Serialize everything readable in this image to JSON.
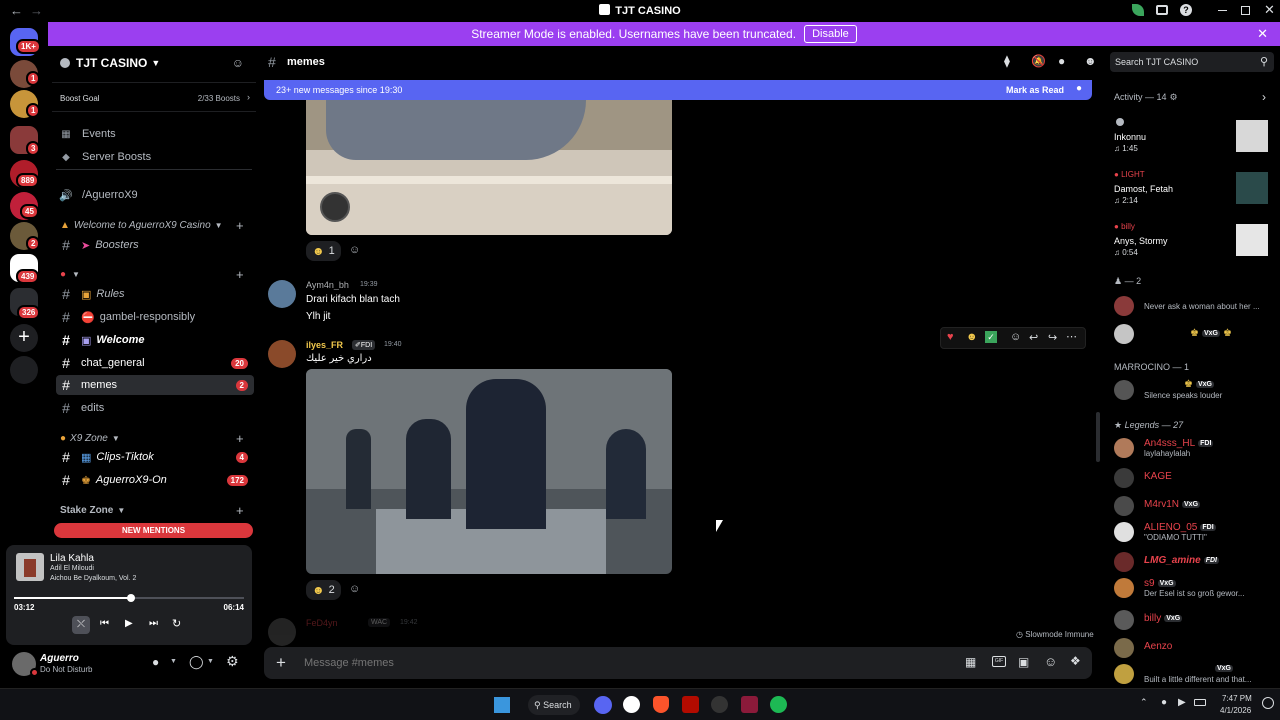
{
  "window": {
    "title": "TJT CASINO"
  },
  "banner": {
    "text": "Streamer Mode is enabled. Usernames have been truncated.",
    "button": "Disable"
  },
  "guild_badges": [
    "1K+",
    "1",
    "1",
    "3",
    "889",
    "45",
    "2",
    "439",
    "326"
  ],
  "server": {
    "name": "TJT CASINO",
    "boost_goal_label": "Boost Goal",
    "boost_count": "2/33 Boosts",
    "events": "Events",
    "server_boosts": "Server Boosts",
    "voice_channel": "/AguerroX9",
    "categories": [
      {
        "label": "Welcome to AguerroX9 Casino"
      },
      {
        "label": "X9 Zone"
      },
      {
        "label": "Stake Zone"
      }
    ],
    "channels": [
      {
        "label": "Boosters",
        "badge": ""
      },
      {
        "label": "Rules",
        "badge": ""
      },
      {
        "label": "gambel-responsibly",
        "badge": ""
      },
      {
        "label": "Welcome",
        "badge": ""
      },
      {
        "label": "chat_general",
        "badge": "20"
      },
      {
        "label": "memes",
        "badge": "2"
      },
      {
        "label": "edits",
        "badge": ""
      },
      {
        "label": "Clips-Tiktok",
        "badge": "4"
      },
      {
        "label": "AguerroX9-On",
        "badge": "172"
      }
    ],
    "new_mentions": "NEW MENTIONS"
  },
  "player": {
    "track": "Lila Kahla",
    "artist": "Adil El Miloudi",
    "album": "Aichou Be Dyalkoum, Vol. 2",
    "elapsed": "03:12",
    "duration": "06:14",
    "progress": 0.51
  },
  "user": {
    "name": "Aguerro",
    "status": "Do Not Disturb"
  },
  "channel_header": {
    "name": "memes"
  },
  "new_messages_bar": {
    "text": "23+ new messages since 19:30",
    "action": "Mark as Read"
  },
  "messages": [
    {
      "reaction_count": "1"
    },
    {
      "author": "Aym4n_bh",
      "time": "19:39",
      "lines": [
        "Drari kifach blan tach",
        "Ylh jit"
      ]
    },
    {
      "author": "ilyes_FR",
      "tag": "FDI",
      "time": "19:40",
      "text": "دراري خير عليك",
      "reaction_count": "2"
    },
    {
      "author": "FeD4yn",
      "tag": "WAC",
      "time": "19:42"
    }
  ],
  "slowmode": "Slowmode Immune",
  "composer": {
    "placeholder": "Message #memes"
  },
  "search": {
    "placeholder": "Search TJT CASINO"
  },
  "activity": {
    "label": "Activity — 14",
    "items": [
      {
        "name": "Inkonnu",
        "duration": "1:45"
      },
      {
        "host": "LIGHT",
        "name": "Damost, Fetah",
        "duration": "2:14"
      },
      {
        "host": "billy",
        "name": "Anys, Stormy",
        "duration": "0:54"
      }
    ]
  },
  "member_groups": [
    {
      "label": "— 2"
    },
    {
      "label": "MARROCINO — 1"
    },
    {
      "label": "Legends — 27"
    }
  ],
  "members": [
    {
      "name": "",
      "status": "Never ask a woman about her ...",
      "tag": ""
    },
    {
      "name": "",
      "status": "",
      "tag": "VxG"
    },
    {
      "name": "",
      "status": "Silence speaks louder",
      "tag": "VxG"
    },
    {
      "name": "An4sss_HL",
      "status": "laylahaylalah",
      "tag": "FDI"
    },
    {
      "name": "KAGE",
      "status": "",
      "tag": ""
    },
    {
      "name": "M4rv1N",
      "status": "",
      "tag": "VxG"
    },
    {
      "name": "ALIENO_05",
      "status": "\"ODIAMO TUTTI\"",
      "tag": "FDI"
    },
    {
      "name": "LMG_amine",
      "status": "",
      "tag": "FDI"
    },
    {
      "name": "s9",
      "status": "Der Esel ist so groß gewor...",
      "tag": "VxG"
    },
    {
      "name": "billy",
      "status": "",
      "tag": "VxG"
    },
    {
      "name": "Aenzo",
      "status": "",
      "tag": ""
    },
    {
      "name": "",
      "status": "Built a little different and that...",
      "tag": "VxG"
    }
  ],
  "taskbar": {
    "search": "Search",
    "time": "7:47 PM",
    "date": "4/1/2026"
  },
  "colors": {
    "accent": "#9b3ff0",
    "blurple": "#5865f2",
    "mention": "#da373c",
    "online": "#23a55a"
  }
}
